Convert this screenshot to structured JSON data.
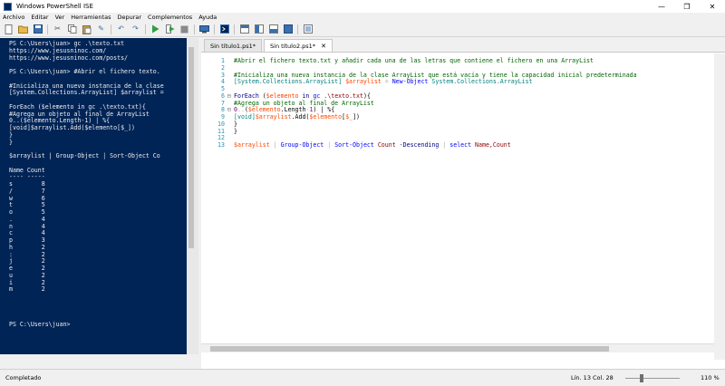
{
  "window": {
    "title": "Windows PowerShell ISE",
    "controls": [
      "—",
      "❐",
      "✕"
    ]
  },
  "menu": [
    "Archivo",
    "Editar",
    "Ver",
    "Herramientas",
    "Depurar",
    "Complementos",
    "Ayuda"
  ],
  "toolbar": [
    "new-file-icon",
    "open-file-icon",
    "save-icon",
    "cut-icon",
    "copy-icon",
    "paste-icon",
    "clear-icon",
    "undo-icon",
    "redo-icon",
    "run-icon",
    "run-selection-icon",
    "stop-icon",
    "remote-icon",
    "powershell-icon",
    "show-script-icon",
    "layout-side-icon",
    "layout-top-icon",
    "layout-max-icon",
    "show-commands-icon"
  ],
  "console": {
    "lines": [
      "PS C:\\Users\\juan> gc .\\texto.txt",
      "https://www.jesusninoc.com/",
      "https://www.jesusninoc.com/posts/",
      "",
      "PS C:\\Users\\juan> #Abrir el fichero texto.",
      "",
      "#Inicializa una nueva instancia de la clase",
      "[System.Collections.ArrayList] $arraylist =",
      "",
      "ForEach ($elemento in gc .\\texto.txt){",
      "#Agrega un objeto al final de ArrayList",
      "0..($elemento.Length-1) | %{",
      "[void]$arraylist.Add($elemento[$_])",
      "}",
      "}",
      "",
      "$arraylist | Group-Object | Sort-Object Co",
      "",
      "Name Count",
      "---- -----",
      "s        8",
      "/        7",
      "w        6",
      "t        5",
      "o        5",
      ".        4",
      "n        4",
      "c        4",
      "p        3",
      "h        2",
      ":        2",
      "j        2",
      "e        2",
      "u        2",
      "i        2",
      "m        2",
      "",
      "",
      "",
      "",
      "PS C:\\Users\\juan>"
    ]
  },
  "tabs": [
    {
      "label": "Sin título1.ps1*",
      "active": false
    },
    {
      "label": "Sin título2.ps1*",
      "active": true,
      "close": "✕"
    }
  ],
  "editor": {
    "line_numbers": [
      "1",
      "2",
      "3",
      "4",
      "5",
      "6",
      "7",
      "8",
      "9",
      "10",
      "11",
      "12",
      "13"
    ],
    "folds": {
      "6": "⊟",
      "8": "⊟"
    },
    "lines": [
      [
        {
          "t": "#Abrir el fichero texto.txt y añadir cada una de las letras que contiene el fichero en una ArrayList",
          "c": "com"
        }
      ],
      [],
      [
        {
          "t": "#Inicializa una nueva instancia de la clase ArrayList que está vacía y tiene la capacidad inicial predeterminada",
          "c": "com"
        }
      ],
      [
        {
          "t": "[System.Collections.ArrayList]",
          "c": "type"
        },
        {
          "t": " ",
          "c": ""
        },
        {
          "t": "$arraylist",
          "c": "var"
        },
        {
          "t": " = ",
          "c": "op"
        },
        {
          "t": "New-Object",
          "c": "cmd"
        },
        {
          "t": " System.Collections.ArrayList",
          "c": "type"
        }
      ],
      [],
      [
        {
          "t": "ForEach",
          "c": "kw"
        },
        {
          "t": " (",
          "c": ""
        },
        {
          "t": "$elemento",
          "c": "var"
        },
        {
          "t": " in ",
          "c": "kw"
        },
        {
          "t": "gc",
          "c": "cmd"
        },
        {
          "t": " .\\texto.txt",
          "c": "str"
        },
        {
          "t": "){",
          "c": ""
        }
      ],
      [
        {
          "t": "#Agrega un objeto al final de ArrayList",
          "c": "com"
        }
      ],
      [
        {
          "t": "0",
          "c": "num"
        },
        {
          "t": "..",
          "c": "op"
        },
        {
          "t": "(",
          "c": ""
        },
        {
          "t": "$elemento",
          "c": "var"
        },
        {
          "t": ".Length",
          "c": "prop"
        },
        {
          "t": "-",
          "c": "op"
        },
        {
          "t": "1",
          "c": "num"
        },
        {
          "t": ") | %{",
          "c": ""
        }
      ],
      [
        {
          "t": "[void]",
          "c": "type"
        },
        {
          "t": "$arraylist",
          "c": "var"
        },
        {
          "t": ".Add(",
          "c": ""
        },
        {
          "t": "$elemento",
          "c": "var"
        },
        {
          "t": "[",
          "c": ""
        },
        {
          "t": "$_",
          "c": "var"
        },
        {
          "t": "])",
          "c": ""
        }
      ],
      [
        {
          "t": "}",
          "c": ""
        }
      ],
      [
        {
          "t": "}",
          "c": ""
        }
      ],
      [],
      [
        {
          "t": "$arraylist",
          "c": "var"
        },
        {
          "t": " | ",
          "c": "op"
        },
        {
          "t": "Group-Object",
          "c": "cmd"
        },
        {
          "t": " | ",
          "c": "op"
        },
        {
          "t": "Sort-Object",
          "c": "cmd"
        },
        {
          "t": " Count ",
          "c": "str"
        },
        {
          "t": "-Descending",
          "c": "param"
        },
        {
          "t": " | ",
          "c": "op"
        },
        {
          "t": "select",
          "c": "cmd"
        },
        {
          "t": " Name,Count",
          "c": "str"
        }
      ]
    ]
  },
  "status": {
    "text": "Completado",
    "position": "Lín. 13  Col. 28",
    "zoom": "110 %"
  },
  "colors": {
    "console_bg": "#012456",
    "comment": "#006400",
    "variable": "#ff4500",
    "command": "#0000ff",
    "type": "#008080",
    "keyword": "#00008b",
    "linenumber": "#2b91af"
  }
}
